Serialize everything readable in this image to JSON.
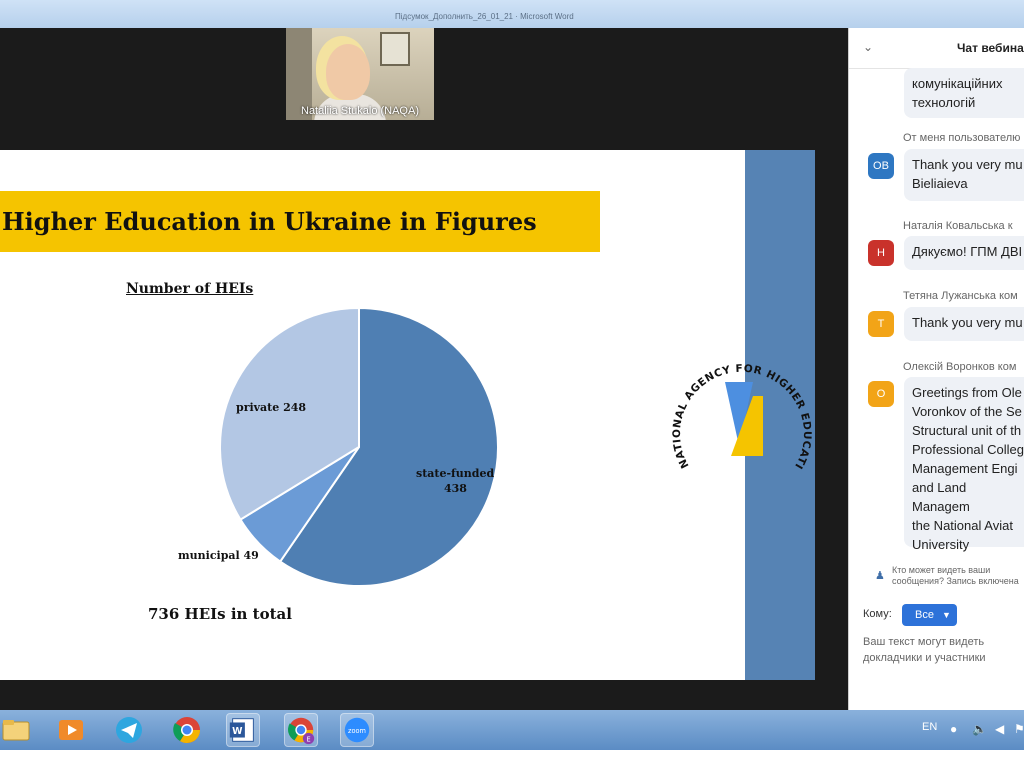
{
  "window": {
    "title": "Підсумок_Дополнить_26_01_21 · Microsoft Word"
  },
  "video": {
    "participant": "Nataliia Stukalo (NAQA)"
  },
  "slide": {
    "title": "Higher Education in Ukraine in Figures",
    "total": "736 HEIs in total",
    "logo_text": "NATIONAL AGENCY FOR HIGHER EDUCATION QUALITY ASSURANCE",
    "label_private": "private 248",
    "label_municipal": "municipal  49",
    "label_state_1": "state-funded",
    "label_state_2": "438"
  },
  "chart_data": {
    "type": "pie",
    "title": "Number of HEIs",
    "slices": [
      {
        "label": "state-funded",
        "value": 438,
        "color": "#4f7fb3"
      },
      {
        "label": "municipal",
        "value": 49,
        "color": "#6b9bd6"
      },
      {
        "label": "private",
        "value": 248,
        "color": "#b3c7e4"
      }
    ]
  },
  "chat": {
    "title": "Чат вебинара",
    "messages": [
      {
        "sender": "",
        "avatar": "",
        "text": [
          "комунікаційних",
          "технологій"
        ]
      },
      {
        "sender": "От меня пользователю",
        "avatar": "OB",
        "avatar_color": "#2e77c2",
        "text": [
          "Thank you very mu",
          "Bieliaieva"
        ]
      },
      {
        "sender": "Наталія Ковальська к",
        "avatar": "Н",
        "avatar_color": "#c9322b",
        "text": [
          "Дякуємо! ГПМ ДВІ"
        ]
      },
      {
        "sender": "Тетяна Лужанська ком",
        "avatar": "Т",
        "avatar_color": "#f2a417",
        "text": [
          "Thank you very mu"
        ]
      },
      {
        "sender": "Олексій Воронков ком",
        "avatar": "О",
        "avatar_color": "#f2a417",
        "text": [
          "Greetings from Ole",
          "Voronkov of the Se",
          "Structural unit of th",
          "Professional Colleg",
          "Management Engi",
          "and Land Managem",
          "the National Aviat",
          "University"
        ]
      }
    ],
    "visibility_note": "Кто может видеть ваши сообщения? Запись включена",
    "to_label": "Кому:",
    "to_value": "Все",
    "hint": "Ваш текст могут видеть докладчики и участники"
  },
  "taskbar": {
    "apps": [
      "file-explorer",
      "media-player",
      "telegram",
      "chrome",
      "word",
      "chrome-profile",
      "zoom"
    ],
    "language": "EN",
    "zoom_label": "zoom",
    "profile_badge": "E"
  }
}
